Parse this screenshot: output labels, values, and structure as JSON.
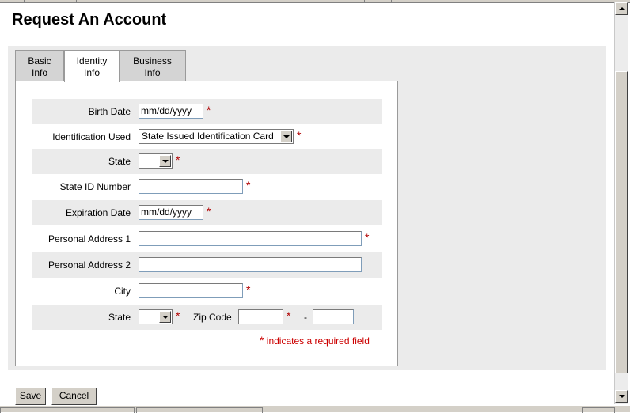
{
  "page": {
    "title": "Request An Account"
  },
  "tabs": [
    {
      "line1": "Basic",
      "line2": "Info",
      "active": false
    },
    {
      "line1": "Identity",
      "line2": "Info",
      "active": true
    },
    {
      "line1": "Business",
      "line2": "Info",
      "active": false
    }
  ],
  "form": {
    "birth_date": {
      "label": "Birth Date",
      "value": "mm/dd/yyyy"
    },
    "identification": {
      "label": "Identification Used",
      "value": "State Issued Identification Card"
    },
    "state": {
      "label": "State",
      "value": ""
    },
    "state_id_number": {
      "label": "State ID Number",
      "value": ""
    },
    "expiration_date": {
      "label": "Expiration Date",
      "value": "mm/dd/yyyy"
    },
    "address1": {
      "label": "Personal Address 1",
      "value": ""
    },
    "address2": {
      "label": "Personal Address 2",
      "value": ""
    },
    "city": {
      "label": "City",
      "value": ""
    },
    "state2": {
      "label": "State",
      "value": ""
    },
    "zip": {
      "label": "Zip Code",
      "value": "",
      "ext_value": "",
      "separator": "-"
    },
    "required_marker": "*",
    "required_note": "indicates a required field"
  },
  "buttons": {
    "save": "Save",
    "cancel": "Cancel"
  },
  "colors": {
    "required": "#cc0000",
    "panel": "#ebebeb",
    "tab_inactive": "#d4d4d4"
  }
}
